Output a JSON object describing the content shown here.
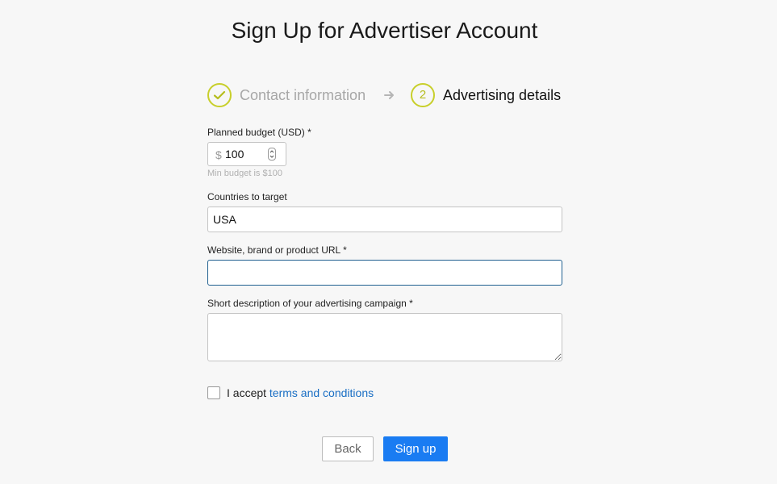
{
  "page": {
    "title": "Sign Up for Advertiser Account"
  },
  "steps": [
    {
      "number": "1",
      "label": "Contact information",
      "state": "completed"
    },
    {
      "number": "2",
      "label": "Advertising details",
      "state": "active"
    }
  ],
  "form": {
    "budget": {
      "label": "Planned budget (USD) *",
      "currency_symbol": "$",
      "value": "100",
      "hint": "Min budget is $100"
    },
    "countries": {
      "label": "Countries to target",
      "value": "USA"
    },
    "url": {
      "label": "Website, brand or product URL  *",
      "value": ""
    },
    "description": {
      "label": "Short description of your advertising campaign  *",
      "value": ""
    },
    "terms": {
      "prefix": "I accept ",
      "link_text": "terms and conditions",
      "checked": false
    }
  },
  "buttons": {
    "back_label": "Back",
    "signup_label": "Sign up"
  },
  "colors": {
    "step_accent": "#c8cf2b",
    "primary_button": "#1a7cf2",
    "link": "#1a6fc4",
    "focus_border": "#1f5f8f"
  }
}
